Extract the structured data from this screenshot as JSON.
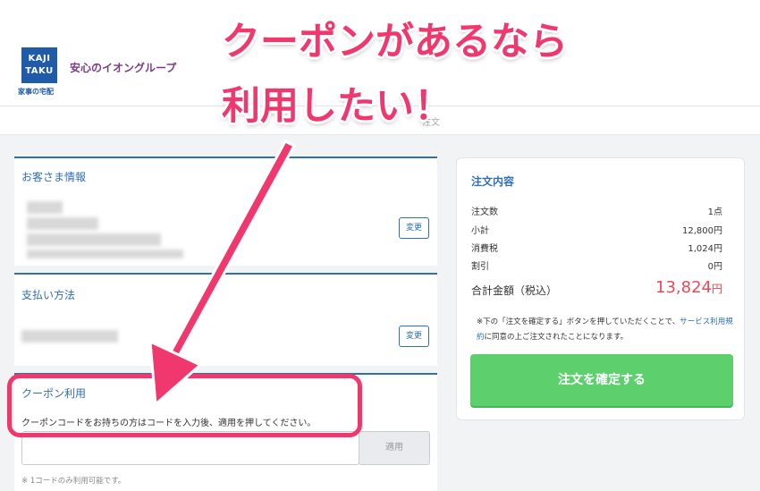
{
  "header": {
    "logo_line1": "KAJI",
    "logo_line2": "TAKU",
    "logo_sub": "家事の宅配",
    "tagline": "安心のイオングループ",
    "step_text": "注文"
  },
  "customer": {
    "title": "お客さま情報",
    "change_label": "変更"
  },
  "payment": {
    "title": "支払い方法",
    "change_label": "変更"
  },
  "coupon": {
    "title": "クーポン利用",
    "description": "クーポンコードをお持ちの方はコードを入力後、適用を押してください。",
    "input_value": "",
    "apply_label": "適用",
    "note": "※ 1コードのみ利用可能です。"
  },
  "order": {
    "title": "注文内容",
    "rows": [
      {
        "label": "注文数",
        "value": "1点"
      },
      {
        "label": "小計",
        "value": "12,800円"
      },
      {
        "label": "消費税",
        "value": "1,024円"
      },
      {
        "label": "割引",
        "value": "0円"
      }
    ],
    "total_label": "合計金額（税込）",
    "total_value": "13,824",
    "total_unit": "円",
    "notice_pre": "※下の「注文を確定する」ボタンを押していただくことで、",
    "notice_link": "サービス利用規約",
    "notice_post": "に同意の上ご注文されたことになります。",
    "confirm_label": "注文を確定する"
  },
  "annotation": {
    "line1": "クーポンがあるなら",
    "line2": "利用したい！"
  },
  "colors": {
    "accent": "#2f6fb4",
    "annotation": "#f0386f",
    "confirm": "#5dd06d",
    "total": "#e94b56"
  }
}
